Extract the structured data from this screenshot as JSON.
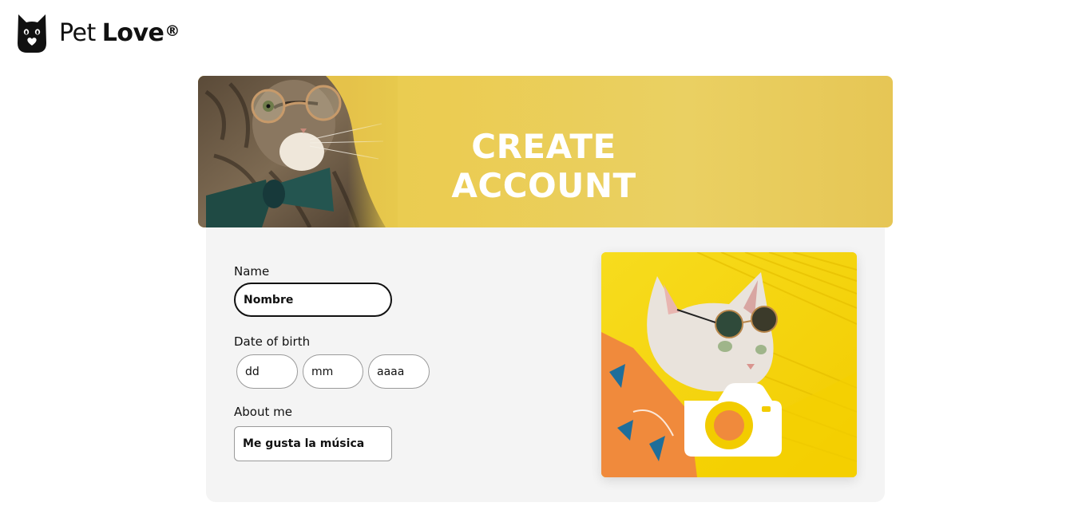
{
  "brand": {
    "name_regular": "Pet",
    "name_bold": "Love",
    "registered_mark": "®",
    "logo_icon": "cat-head-icon"
  },
  "banner": {
    "title": "CREATE ACCOUNT",
    "image": "cat-with-glasses-bowtie"
  },
  "form": {
    "name": {
      "label": "Name",
      "placeholder": "Nombre"
    },
    "dob": {
      "label": "Date of birth",
      "day_placeholder": "dd",
      "month_placeholder": "mm",
      "year_placeholder": "aaaa"
    },
    "about": {
      "label": "About me",
      "placeholder": "Me gusta la música"
    }
  },
  "photo": {
    "image": "cat-with-sunglasses-hammock",
    "overlay_icon": "camera-icon"
  },
  "colors": {
    "banner_yellow": "#e9cb55",
    "panel_bg": "#f4f4f4",
    "text": "#111111"
  }
}
